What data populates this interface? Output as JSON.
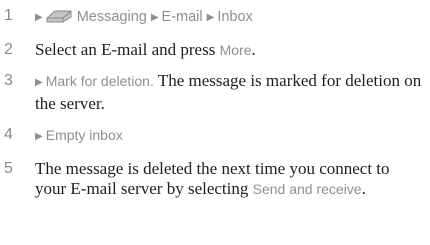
{
  "icons": {
    "arrow": "triangle-right",
    "messaging": "envelope-icon"
  },
  "steps": [
    {
      "number": "1",
      "path": [
        "Messaging",
        "E-mail",
        "Inbox"
      ]
    },
    {
      "number": "2",
      "text_before": "Select an E-mail and press ",
      "ui_term": "More",
      "text_after": "."
    },
    {
      "number": "3",
      "ui_term": "Mark for deletion.",
      "text_after": " The message is marked for deletion on the server."
    },
    {
      "number": "4",
      "ui_term": "Empty inbox"
    },
    {
      "number": "5",
      "text_before": "The message is deleted the next time you connect to your E-mail server by selecting ",
      "ui_term": "Send and receive",
      "text_after": "."
    }
  ]
}
